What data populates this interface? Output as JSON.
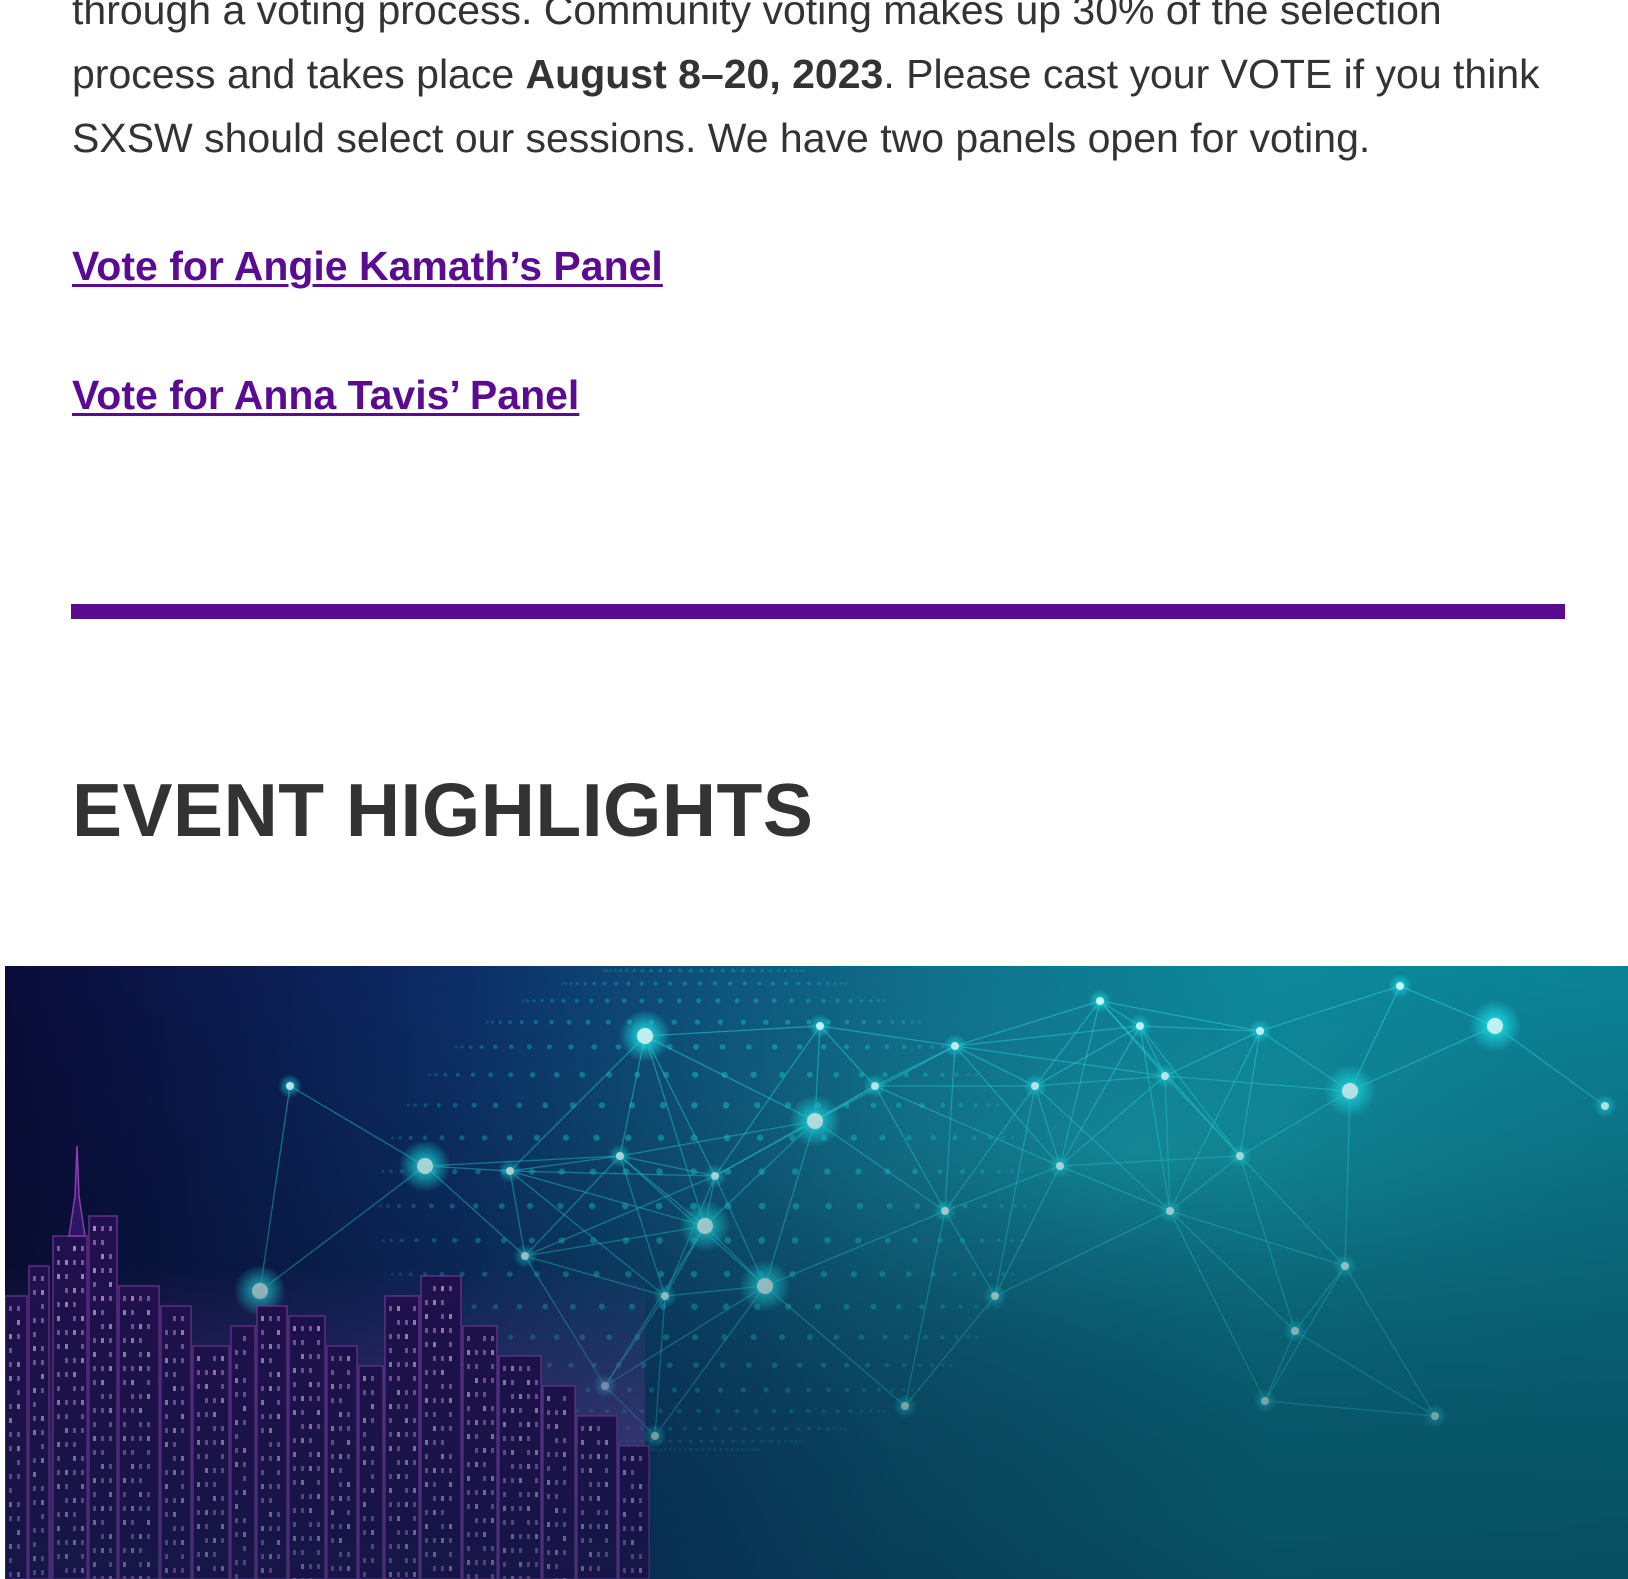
{
  "intro": {
    "line_before": "through a voting process. Community voting makes up 30% of the selection process and takes place ",
    "date_bold": "August 8–20, 2023",
    "line_after": ". Please cast your VOTE if you think SXSW should select our sessions. We have two panels open for voting."
  },
  "links": {
    "angie": "Vote for Angie Kamath’s Panel",
    "anna": "Vote for Anna Tavis’ Panel"
  },
  "section": {
    "heading": "EVENT HIGHLIGHTS"
  },
  "colors": {
    "link": "#5b0b92",
    "divider": "#5b0b92",
    "text": "#333333",
    "hero_cyan": "#19e0ea",
    "hero_purple": "#b04ad8"
  },
  "hero": {
    "icon": "city-network-illustration"
  }
}
